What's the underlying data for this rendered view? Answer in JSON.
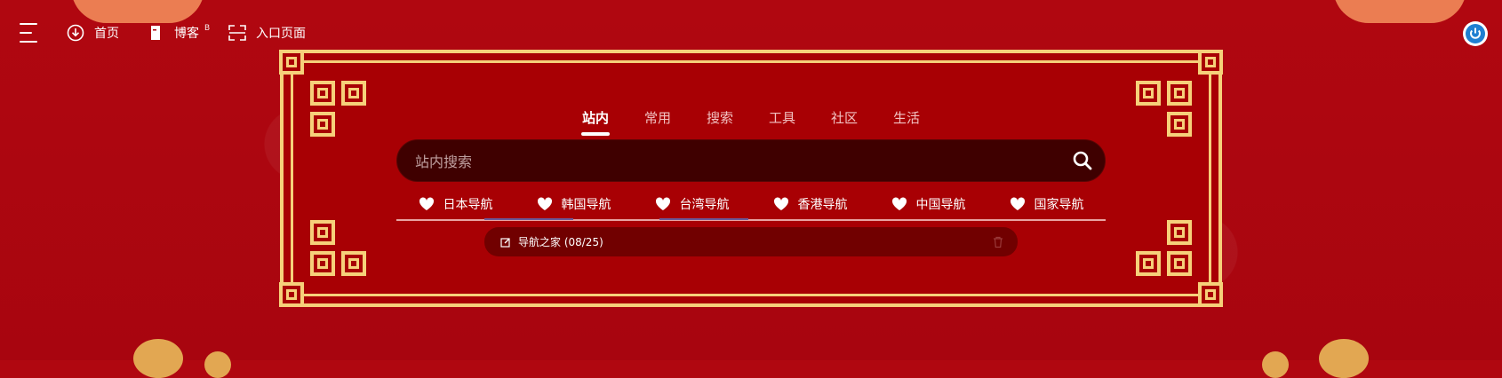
{
  "topbar": {
    "nav": [
      {
        "label": "首页",
        "icon": "download-circle-icon"
      },
      {
        "label": "博客",
        "icon": "bookmark-icon",
        "badge": "B"
      },
      {
        "label": "入口页面",
        "icon": "scan-frame-icon"
      }
    ]
  },
  "search": {
    "tabs": [
      "站内",
      "常用",
      "搜索",
      "工具",
      "社区",
      "生活"
    ],
    "active_tab": "站内",
    "placeholder": "站内搜索"
  },
  "quicklinks": [
    "日本导航",
    "韩国导航",
    "台湾导航",
    "香港导航",
    "中国导航",
    "国家导航"
  ],
  "history": {
    "item": "导航之家 (08/25)"
  },
  "colors": {
    "background": "#a8050f",
    "frame_gold": "#f6d07a",
    "search_bg": "#3f0000",
    "accent_blue": "#1f7fd1"
  }
}
